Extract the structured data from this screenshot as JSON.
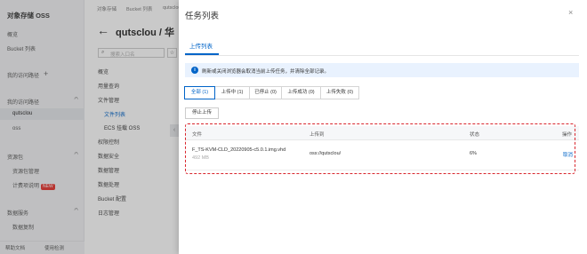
{
  "sidebar": {
    "title": "对象存储 OSS",
    "items": {
      "overview": "概览",
      "bucket_list": "Bucket 列表",
      "my_paths": "我的访问路径",
      "recent": "我的访问路径",
      "qutsclou": "qutsclou",
      "oss_more": "oss",
      "resource_pack": "资源包",
      "resource_mgmt": "资源包管理",
      "billing": "计费项说明",
      "new_badge": "NEW",
      "data_service": "数据服务",
      "data_copy": "数据复制"
    },
    "footer": {
      "left": "帮助文档",
      "right": "使用检测"
    }
  },
  "middle": {
    "breadcrumb": [
      "对象存储",
      "Bucket 列表",
      "qutsclou"
    ],
    "title": "qutsclou / 华",
    "search_placeholder": "搜索入口名",
    "menu": {
      "overview": "概览",
      "user_data": "用量查询",
      "file_mgmt": "文件管理",
      "file_list": "文件列表",
      "ecs_mount": "ECS 挂载 OSS",
      "permission": "权限控制",
      "data_security": "数据安全",
      "data_mgmt": "数据管理",
      "data_process": "数据处理",
      "bucket_config": "Bucket 配置",
      "log_mgmt": "日志管理"
    }
  },
  "drawer": {
    "title": "任务列表",
    "tab": "上传列表",
    "notice": "刷新或关闭浏览器会取消当前上传任务，并清除全部记录。",
    "filters": [
      {
        "label": "全部 (1)",
        "active": true
      },
      {
        "label": "上传中 (1)",
        "active": false
      },
      {
        "label": "已停止 (0)",
        "active": false
      },
      {
        "label": "上传成功 (0)",
        "active": false
      },
      {
        "label": "上传失败 (0)",
        "active": false
      }
    ],
    "stop_button": "停止上传",
    "table": {
      "headers": {
        "file": "文件",
        "dest": "上传到",
        "status": "状态",
        "action": "操作"
      },
      "rows": [
        {
          "file": "F_TS-KVM-CLD_20220905-c5.0.1.img.vhd",
          "size": "492 MB",
          "dest": "oss://qutsclou/",
          "status": "6%",
          "action": "取消"
        }
      ]
    }
  },
  "colors": {
    "accent": "#0064c8",
    "highlight_border": "#d9252c",
    "notice_bg": "#e9f2fe",
    "new_badge": "#e6312b"
  }
}
